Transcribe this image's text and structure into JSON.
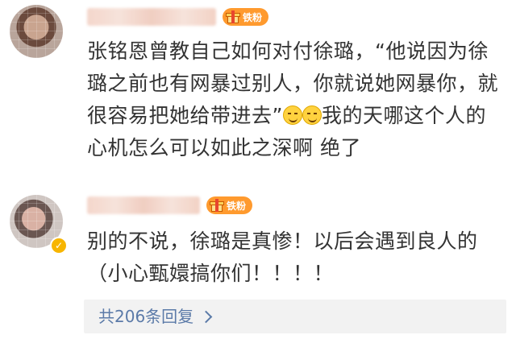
{
  "comments": [
    {
      "badge_label": "铁粉",
      "text_segments": [
        "张铭恩曾教自己如何对付徐璐，“他说因为徐璐之前也有网暴过别人，你就说她网暴你，就很容易把她给带进去”",
        "我的天哪这个人的心机怎么可以如此之深啊 绝了"
      ],
      "emoji_count": 2
    },
    {
      "badge_label": "铁粉",
      "text": "别的不说，徐璐是真惨！以后会遇到良人的（小心甄嬛搞你们！！！！",
      "verified": true
    }
  ],
  "replies": {
    "label": "共206条回复"
  },
  "colors": {
    "badge": "#ff9a2e",
    "link": "#5b7aa8",
    "text": "#333333",
    "reply_bg": "#f2f2f2"
  }
}
